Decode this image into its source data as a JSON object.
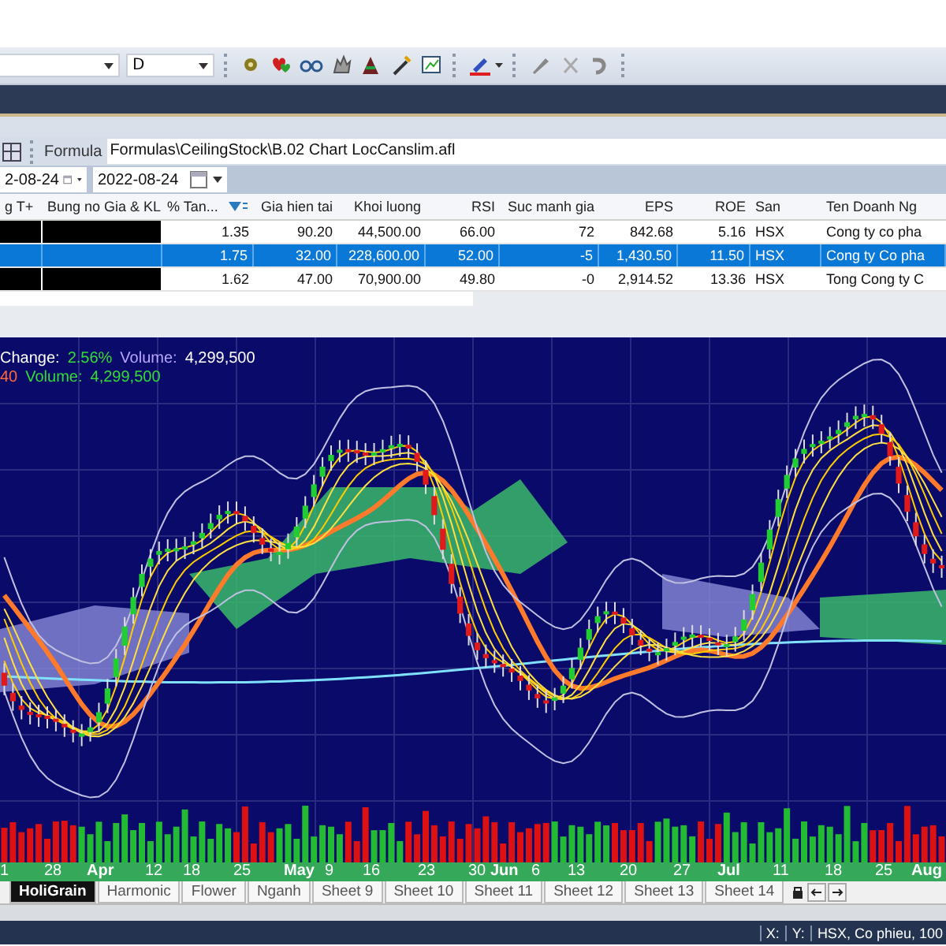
{
  "toolbar": {
    "interval_dropdown": {
      "value": "D"
    }
  },
  "formula_bar": {
    "label": "Formula",
    "path": "Formulas\\CeilingStock\\B.02 Chart LocCanslim.afl"
  },
  "date_range": {
    "from": "2-08-24",
    "to": "2022-08-24"
  },
  "table": {
    "columns": [
      "g T+",
      "Bung no Gia & KL",
      "% Tan...",
      "Gia hien tai",
      "Khoi luong",
      "RSI",
      "Suc manh gia",
      "EPS",
      "ROE",
      "San",
      "Ten Doanh Ng"
    ],
    "rows": [
      {
        "selected": false,
        "cells": [
          "",
          "",
          "1.35",
          "90.20",
          "44,500.00",
          "66.00",
          "72",
          "842.68",
          "5.16",
          "HSX",
          "Cong ty co pha"
        ]
      },
      {
        "selected": true,
        "cells": [
          "",
          "",
          "1.75",
          "32.00",
          "228,600.00",
          "52.00",
          "-5",
          "1,430.50",
          "11.50",
          "HSX",
          "Cong ty Co pha"
        ]
      },
      {
        "selected": false,
        "cells": [
          "",
          "",
          "1.62",
          "47.00",
          "70,900.00",
          "49.80",
          "-0",
          "2,914.52",
          "13.36",
          "HSX",
          "Tong Cong ty C"
        ]
      }
    ]
  },
  "chart": {
    "header": [
      [
        {
          "text": "Change:",
          "color": "#ffffff"
        },
        {
          "text": "2.56%",
          "color": "#33dd33"
        },
        {
          "text": "Volume:",
          "color": "#b9a6ff"
        },
        {
          "text": "4,299,500",
          "color": "#ffffff"
        }
      ],
      [
        {
          "text": "40",
          "color": "#ff6a3d"
        },
        {
          "text": "Volume:",
          "color": "#33dd33"
        },
        {
          "text": "4,299,500",
          "color": "#33dd33"
        }
      ]
    ],
    "axis_labels": [
      {
        "text": "1",
        "kind": "day"
      },
      {
        "text": "28",
        "kind": "day"
      },
      {
        "text": "Apr",
        "kind": "month"
      },
      {
        "text": "12",
        "kind": "day"
      },
      {
        "text": "18",
        "kind": "day"
      },
      {
        "text": "25",
        "kind": "day"
      },
      {
        "text": "May",
        "kind": "month"
      },
      {
        "text": "9",
        "kind": "day"
      },
      {
        "text": "16",
        "kind": "day"
      },
      {
        "text": "23",
        "kind": "day"
      },
      {
        "text": "30",
        "kind": "day"
      },
      {
        "text": "Jun",
        "kind": "month"
      },
      {
        "text": "6",
        "kind": "day"
      },
      {
        "text": "13",
        "kind": "day"
      },
      {
        "text": "20",
        "kind": "day"
      },
      {
        "text": "27",
        "kind": "day"
      },
      {
        "text": "Jul",
        "kind": "month"
      },
      {
        "text": "11",
        "kind": "day"
      },
      {
        "text": "18",
        "kind": "day"
      },
      {
        "text": "25",
        "kind": "day"
      },
      {
        "text": "Aug",
        "kind": "month"
      }
    ]
  },
  "sheet_tabs": [
    {
      "label": "HoliGrain",
      "selected": true
    },
    {
      "label": "Harmonic",
      "selected": false
    },
    {
      "label": "Flower",
      "selected": false
    },
    {
      "label": "Nganh",
      "selected": false
    },
    {
      "label": "Sheet 9",
      "selected": false
    },
    {
      "label": "Sheet 10",
      "selected": false
    },
    {
      "label": "Sheet 11",
      "selected": false
    },
    {
      "label": "Sheet 12",
      "selected": false
    },
    {
      "label": "Sheet 13",
      "selected": false
    },
    {
      "label": "Sheet 14",
      "selected": false
    }
  ],
  "status_bar": [
    "X:",
    "Y:",
    "HSX, Co phieu, 100"
  ]
}
